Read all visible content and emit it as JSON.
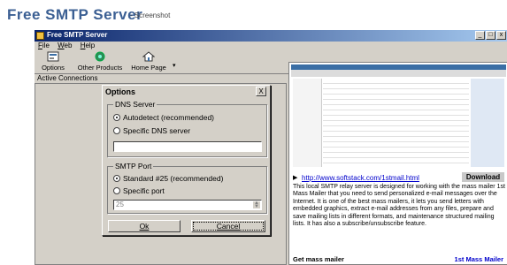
{
  "page": {
    "title": "Free SMTP Server",
    "subtitle": "- Screenshot"
  },
  "window": {
    "title": "Free SMTP Server",
    "controls": [
      "_",
      "□",
      "x"
    ],
    "menu": [
      {
        "label": "File",
        "key": "F"
      },
      {
        "label": "Web",
        "key": "W"
      },
      {
        "label": "Help",
        "key": "H"
      }
    ],
    "toolbar": {
      "options": "Options",
      "other_products": "Other Products",
      "home_page": "Home Page"
    },
    "connections_label": "Active Connections"
  },
  "dialog": {
    "title": "Options",
    "close": "X",
    "dns": {
      "legend": "DNS Server",
      "autodetect": "Autodetect (recommended)",
      "specific": "Specific DNS server",
      "value": ""
    },
    "smtp": {
      "legend": "SMTP Port",
      "standard": "Standard #25 (recommended)",
      "specific": "Specific port",
      "value": "25"
    },
    "ok": "Ok",
    "cancel": "Cancel"
  },
  "preview": {
    "link": "http://www.softstack.com/1stmail.html",
    "download": "Download",
    "description": "This local SMTP relay server is designed for working with the mass mailer 1st Mass Mailer that you need to send personalized e-mail messages over the Internet. It is one of the best mass mailers, it lets you send letters with embedded graphics, extract e-mail addresses from any files, prepare and save mailing lists in different formats, and maintenance structured mailing lists. It has also a subscribe/unsubscribe feature.",
    "footer_left": "Get mass mailer",
    "footer_right": "1st Mass Mailer"
  },
  "colors": {
    "title_blue": "#3b5f93",
    "titlebar_start": "#0a246a",
    "titlebar_end": "#a6caf0",
    "face": "#d4d0c8",
    "link": "#0000cc"
  }
}
